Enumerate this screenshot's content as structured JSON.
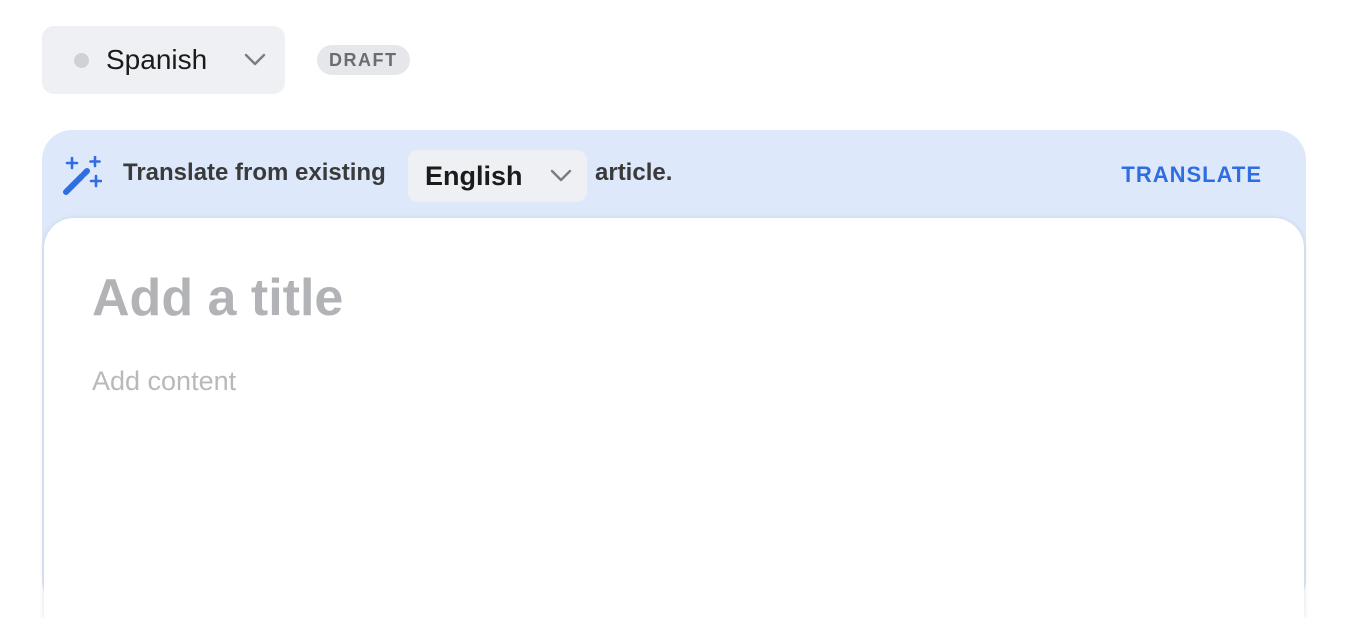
{
  "language_select": {
    "value": "Spanish",
    "status_color": "#cfd1d6",
    "icon": "chevron-down-icon"
  },
  "status_badge": {
    "label": "DRAFT"
  },
  "translate_bar": {
    "icon": "magic-wand-icon",
    "prefix": "Translate from existing",
    "source_language": "English",
    "suffix": "article.",
    "action_label": "TRANSLATE",
    "accent_color": "#2f6ee0",
    "background_color": "#dde8fb"
  },
  "editor": {
    "title_placeholder": "Add a title",
    "content_placeholder": "Add content"
  }
}
